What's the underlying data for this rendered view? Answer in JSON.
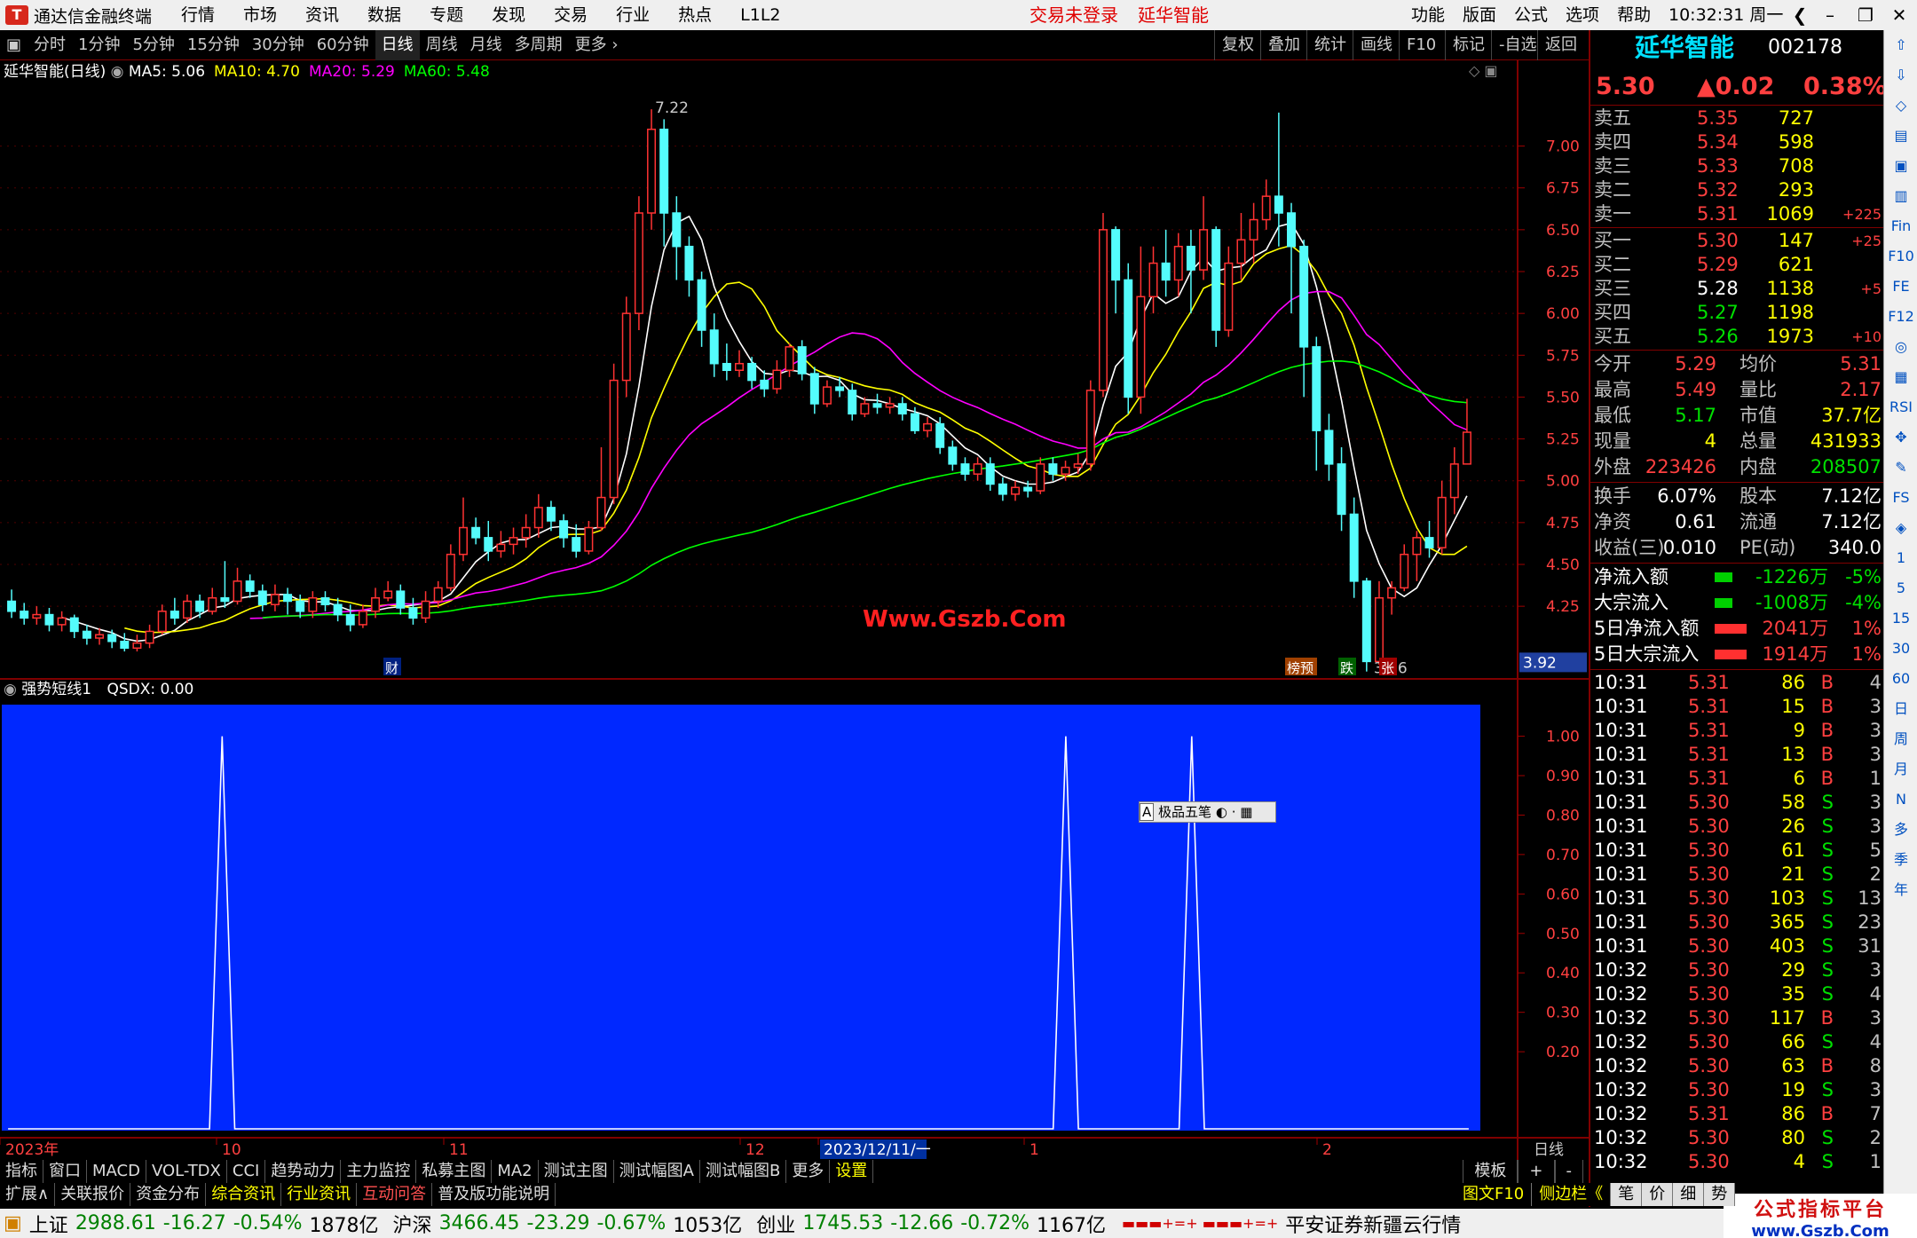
{
  "app": {
    "title": "通达信金融终端",
    "logo": "T"
  },
  "menu": [
    "行情",
    "市场",
    "资讯",
    "数据",
    "专题",
    "发现",
    "交易",
    "行业",
    "热点",
    "L1L2"
  ],
  "warn_login": "交易未登录",
  "warn_stock": "延华智能",
  "right_menu": [
    "功能",
    "版面",
    "公式",
    "选项",
    "帮助"
  ],
  "clock": "10:32:31",
  "weekday": "周一",
  "periods": [
    "分时",
    "1分钟",
    "5分钟",
    "15分钟",
    "30分钟",
    "60分钟",
    "日线",
    "周线",
    "月线",
    "多周期",
    "更多 ›"
  ],
  "active_period": "日线",
  "right_buttons": [
    "复权",
    "叠加",
    "统计",
    "画线",
    "F10",
    "标记",
    "-自选",
    "返回"
  ],
  "ma_legend": {
    "stock": "延华智能(日线)",
    "items": [
      {
        "label": "MA5: 5.06",
        "color": "#ffffff"
      },
      {
        "label": "MA10: 4.70",
        "color": "#ffff00"
      },
      {
        "label": "MA20: 5.29",
        "color": "#ff00ff"
      },
      {
        "label": "MA60: 5.48",
        "color": "#00ff00"
      }
    ]
  },
  "indicator_legend": {
    "name": "强势短线1",
    "value": "QSDX: 0.00"
  },
  "price_axis": [
    "7.00",
    "6.75",
    "6.50",
    "6.25",
    "6.00",
    "5.75",
    "5.50",
    "5.25",
    "5.00",
    "4.75",
    "4.50",
    "4.25"
  ],
  "price_axis_current": "3.92",
  "ind_axis": [
    "1.00",
    "0.90",
    "0.80",
    "0.70",
    "0.60",
    "0.50",
    "0.40",
    "0.30",
    "0.20"
  ],
  "annotations": {
    "high": "7.22",
    "low": "3.86",
    "watermark": "Www.Gszb.Com",
    "cai": "财",
    "bangyu": "榜预",
    "die": "跌",
    "zhang": "张",
    "ime": "极品五笔"
  },
  "date_axis": [
    "2023年",
    "10",
    "11",
    "12",
    "2023/12/11/一",
    "1",
    "2"
  ],
  "date_axis_right": "日线",
  "quote": {
    "name": "延华智能",
    "code": "002178",
    "price": "5.30",
    "change": "▲0.02",
    "pct": "0.38%",
    "asks": [
      {
        "label": "卖五",
        "price": "5.35",
        "vol": "727",
        "delta": ""
      },
      {
        "label": "卖四",
        "price": "5.34",
        "vol": "598",
        "delta": ""
      },
      {
        "label": "卖三",
        "price": "5.33",
        "vol": "708",
        "delta": ""
      },
      {
        "label": "卖二",
        "price": "5.32",
        "vol": "293",
        "delta": ""
      },
      {
        "label": "卖一",
        "price": "5.31",
        "vol": "1069",
        "delta": "+225"
      }
    ],
    "bids": [
      {
        "label": "买一",
        "price": "5.30",
        "vol": "147",
        "delta": "+25"
      },
      {
        "label": "买二",
        "price": "5.29",
        "vol": "621",
        "delta": ""
      },
      {
        "label": "买三",
        "price": "5.28",
        "vol": "1138",
        "delta": "+5"
      },
      {
        "label": "买四",
        "price": "5.27",
        "vol": "1198",
        "delta": ""
      },
      {
        "label": "买五",
        "price": "5.26",
        "vol": "1973",
        "delta": "+10"
      }
    ],
    "stats": [
      {
        "l1": "今开",
        "v1": "5.29",
        "l2": "均价",
        "v2": "5.31"
      },
      {
        "l1": "最高",
        "v1": "5.49",
        "l2": "量比",
        "v2": "2.17"
      },
      {
        "l1": "最低",
        "v1": "5.17",
        "l2": "市值",
        "v2": "37.7亿"
      },
      {
        "l1": "现量",
        "v1": "4",
        "l2": "总量",
        "v2": "431933"
      },
      {
        "l1": "外盘",
        "v1": "223426",
        "l2": "内盘",
        "v2": "208507"
      }
    ],
    "stats2": [
      {
        "l1": "换手",
        "v1": "6.07%",
        "l2": "股本",
        "v2": "7.12亿"
      },
      {
        "l1": "净资",
        "v1": "0.61",
        "l2": "流通",
        "v2": "7.12亿"
      },
      {
        "l1": "收益(三)",
        "v1": "0.010",
        "l2": "PE(动)",
        "v2": "340.0"
      }
    ],
    "flows": [
      {
        "label": "净流入额",
        "bar": "grn",
        "value": "-1226万",
        "pct": "-5%"
      },
      {
        "label": "大宗流入",
        "bar": "grn",
        "value": "-1008万",
        "pct": "-4%"
      },
      {
        "label": "5日净流入额",
        "bar": "red",
        "value": "2041万",
        "pct": "1%"
      },
      {
        "label": "5日大宗流入",
        "bar": "red",
        "value": "1914万",
        "pct": "1%"
      }
    ],
    "ticks": [
      {
        "t": "10:31",
        "p": "5.31",
        "v": "86",
        "bs": "B",
        "n": "4"
      },
      {
        "t": "10:31",
        "p": "5.31",
        "v": "15",
        "bs": "B",
        "n": "3"
      },
      {
        "t": "10:31",
        "p": "5.31",
        "v": "9",
        "bs": "B",
        "n": "3"
      },
      {
        "t": "10:31",
        "p": "5.31",
        "v": "13",
        "bs": "B",
        "n": "3"
      },
      {
        "t": "10:31",
        "p": "5.31",
        "v": "6",
        "bs": "B",
        "n": "1"
      },
      {
        "t": "10:31",
        "p": "5.30",
        "v": "58",
        "bs": "S",
        "n": "3"
      },
      {
        "t": "10:31",
        "p": "5.30",
        "v": "26",
        "bs": "S",
        "n": "3"
      },
      {
        "t": "10:31",
        "p": "5.30",
        "v": "61",
        "bs": "S",
        "n": "5"
      },
      {
        "t": "10:31",
        "p": "5.30",
        "v": "21",
        "bs": "S",
        "n": "2"
      },
      {
        "t": "10:31",
        "p": "5.30",
        "v": "103",
        "bs": "S",
        "n": "13"
      },
      {
        "t": "10:31",
        "p": "5.30",
        "v": "365",
        "bs": "S",
        "n": "23"
      },
      {
        "t": "10:31",
        "p": "5.30",
        "v": "403",
        "bs": "S",
        "n": "31"
      },
      {
        "t": "10:32",
        "p": "5.30",
        "v": "29",
        "bs": "S",
        "n": "3"
      },
      {
        "t": "10:32",
        "p": "5.30",
        "v": "35",
        "bs": "S",
        "n": "4"
      },
      {
        "t": "10:32",
        "p": "5.30",
        "v": "117",
        "bs": "B",
        "n": "3"
      },
      {
        "t": "10:32",
        "p": "5.30",
        "v": "66",
        "bs": "S",
        "n": "4"
      },
      {
        "t": "10:32",
        "p": "5.30",
        "v": "63",
        "bs": "B",
        "n": "8"
      },
      {
        "t": "10:32",
        "p": "5.30",
        "v": "19",
        "bs": "S",
        "n": "3"
      },
      {
        "t": "10:32",
        "p": "5.31",
        "v": "86",
        "bs": "B",
        "n": "7"
      },
      {
        "t": "10:32",
        "p": "5.30",
        "v": "80",
        "bs": "S",
        "n": "2"
      },
      {
        "t": "10:32",
        "p": "5.30",
        "v": "4",
        "bs": "S",
        "n": "1"
      }
    ]
  },
  "sidebar_items": [
    "⇧",
    "⇩",
    "◇",
    "▤",
    "▣",
    "▥",
    "Fin",
    "F10",
    "FE",
    "F12",
    "◎",
    "▦",
    "RSI",
    "✥",
    "✎",
    "FS",
    "◈",
    "1",
    "5",
    "15",
    "30",
    "60",
    "日",
    "周",
    "月",
    "N",
    "多",
    "季",
    "年"
  ],
  "bottom_tabs": [
    "指标",
    "窗口",
    "MACD",
    "VOL-TDX",
    "CCI",
    "趋势动力",
    "主力监控",
    "私募主图",
    "MA2",
    "测试主图",
    "测试幅图A",
    "测试幅图B",
    "更多",
    "设置"
  ],
  "bottom_right": [
    "模板",
    "+",
    "-"
  ],
  "bottom_tabs2": [
    {
      "label": "扩展∧",
      "color": "#ddd"
    },
    {
      "label": "关联报价",
      "color": "#ddd"
    },
    {
      "label": "资金分布",
      "color": "#ddd"
    },
    {
      "label": "综合资讯",
      "color": "#ffff00"
    },
    {
      "label": "行业资讯",
      "color": "#ffff00"
    },
    {
      "label": "互动问答",
      "color": "#ff5050"
    },
    {
      "label": "普及版功能说明",
      "color": "#ddd"
    }
  ],
  "bottom_tabs2_right": [
    "图文F10",
    "侧边栏《",
    "笔",
    "价",
    "细",
    "势"
  ],
  "status": {
    "sh_label": "上证",
    "sh_val": "2988.61",
    "sh_chg": "-16.27",
    "sh_pct": "-0.54%",
    "sh_amt": "1878亿",
    "hs_label": "沪深",
    "hs_val": "3466.45",
    "hs_chg": "-23.29",
    "hs_pct": "-0.67%",
    "hs_amt": "1053亿",
    "cy_label": "创业",
    "cy_val": "1745.53",
    "cy_chg": "-12.66",
    "cy_pct": "-0.72%",
    "cy_amt": "1167亿",
    "broker": "平安证券新疆云行情",
    "brand": "公式指标平台",
    "brand_url": "www.Gszb.Com"
  },
  "chart_data": {
    "type": "candlestick",
    "ylim": [
      3.8,
      7.3
    ],
    "candles": [
      [
        4.28,
        4.22,
        4.35,
        4.18
      ],
      [
        4.22,
        4.18,
        4.27,
        4.14
      ],
      [
        4.18,
        4.2,
        4.25,
        4.14
      ],
      [
        4.2,
        4.14,
        4.24,
        4.1
      ],
      [
        4.14,
        4.18,
        4.22,
        4.1
      ],
      [
        4.18,
        4.1,
        4.2,
        4.06
      ],
      [
        4.1,
        4.06,
        4.14,
        4.02
      ],
      [
        4.06,
        4.08,
        4.12,
        4.02
      ],
      [
        4.08,
        4.04,
        4.11,
        4.0
      ],
      [
        4.04,
        4.0,
        4.09,
        3.98
      ],
      [
        4.0,
        4.03,
        4.08,
        3.98
      ],
      [
        4.03,
        4.1,
        4.14,
        4.0
      ],
      [
        4.1,
        4.22,
        4.26,
        4.08
      ],
      [
        4.22,
        4.18,
        4.3,
        4.14
      ],
      [
        4.18,
        4.28,
        4.32,
        4.15
      ],
      [
        4.28,
        4.22,
        4.32,
        4.18
      ],
      [
        4.22,
        4.3,
        4.36,
        4.2
      ],
      [
        4.3,
        4.28,
        4.52,
        4.24
      ],
      [
        4.28,
        4.4,
        4.48,
        4.26
      ],
      [
        4.4,
        4.34,
        4.44,
        4.3
      ],
      [
        4.34,
        4.26,
        4.38,
        4.22
      ],
      [
        4.26,
        4.32,
        4.38,
        4.22
      ],
      [
        4.32,
        4.28,
        4.36,
        4.2
      ],
      [
        4.28,
        4.22,
        4.32,
        4.18
      ],
      [
        4.22,
        4.3,
        4.34,
        4.18
      ],
      [
        4.3,
        4.26,
        4.34,
        4.22
      ],
      [
        4.26,
        4.2,
        4.3,
        4.16
      ],
      [
        4.2,
        4.14,
        4.26,
        4.1
      ],
      [
        4.14,
        4.22,
        4.26,
        4.12
      ],
      [
        4.22,
        4.3,
        4.36,
        4.18
      ],
      [
        4.3,
        4.34,
        4.4,
        4.28
      ],
      [
        4.34,
        4.24,
        4.38,
        4.2
      ],
      [
        4.24,
        4.18,
        4.3,
        4.14
      ],
      [
        4.18,
        4.28,
        4.34,
        4.15
      ],
      [
        4.28,
        4.36,
        4.4,
        4.24
      ],
      [
        4.36,
        4.56,
        4.62,
        4.34
      ],
      [
        4.56,
        4.72,
        4.9,
        4.52
      ],
      [
        4.72,
        4.66,
        4.78,
        4.62
      ],
      [
        4.66,
        4.58,
        4.76,
        4.52
      ],
      [
        4.58,
        4.62,
        4.7,
        4.54
      ],
      [
        4.62,
        4.66,
        4.72,
        4.56
      ],
      [
        4.66,
        4.72,
        4.8,
        4.6
      ],
      [
        4.72,
        4.84,
        4.92,
        4.66
      ],
      [
        4.84,
        4.76,
        4.88,
        4.7
      ],
      [
        4.76,
        4.66,
        4.8,
        4.6
      ],
      [
        4.66,
        4.58,
        4.74,
        4.54
      ],
      [
        4.58,
        4.72,
        4.76,
        4.56
      ],
      [
        4.72,
        4.9,
        5.2,
        4.7
      ],
      [
        4.9,
        5.6,
        5.7,
        4.86
      ],
      [
        5.6,
        6.0,
        6.1,
        5.5
      ],
      [
        6.0,
        6.6,
        6.7,
        5.9
      ],
      [
        6.6,
        7.1,
        7.22,
        6.5
      ],
      [
        7.1,
        6.6,
        7.16,
        6.4
      ],
      [
        6.6,
        6.4,
        6.7,
        6.2
      ],
      [
        6.4,
        6.2,
        6.46,
        6.1
      ],
      [
        6.2,
        5.9,
        6.25,
        5.8
      ],
      [
        5.9,
        5.7,
        6.0,
        5.62
      ],
      [
        5.7,
        5.66,
        5.82,
        5.6
      ],
      [
        5.66,
        5.7,
        5.78,
        5.62
      ],
      [
        5.7,
        5.6,
        5.74,
        5.55
      ],
      [
        5.6,
        5.55,
        5.66,
        5.5
      ],
      [
        5.55,
        5.66,
        5.72,
        5.52
      ],
      [
        5.66,
        5.8,
        5.82,
        5.62
      ],
      [
        5.8,
        5.64,
        5.84,
        5.6
      ],
      [
        5.64,
        5.46,
        5.68,
        5.4
      ],
      [
        5.46,
        5.56,
        5.6,
        5.44
      ],
      [
        5.56,
        5.54,
        5.62,
        5.5
      ],
      [
        5.54,
        5.4,
        5.58,
        5.36
      ],
      [
        5.4,
        5.46,
        5.5,
        5.38
      ],
      [
        5.46,
        5.44,
        5.52,
        5.4
      ],
      [
        5.44,
        5.46,
        5.5,
        5.4
      ],
      [
        5.46,
        5.4,
        5.5,
        5.36
      ],
      [
        5.4,
        5.3,
        5.44,
        5.28
      ],
      [
        5.3,
        5.34,
        5.38,
        5.26
      ],
      [
        5.34,
        5.2,
        5.38,
        5.16
      ],
      [
        5.2,
        5.1,
        5.24,
        5.06
      ],
      [
        5.1,
        5.04,
        5.14,
        5.0
      ],
      [
        5.04,
        5.1,
        5.14,
        5.0
      ],
      [
        5.1,
        4.98,
        5.14,
        4.94
      ],
      [
        4.98,
        4.92,
        5.02,
        4.88
      ],
      [
        4.92,
        4.96,
        5.0,
        4.88
      ],
      [
        4.96,
        4.94,
        5.0,
        4.9
      ],
      [
        4.94,
        5.1,
        5.14,
        4.92
      ],
      [
        5.1,
        5.04,
        5.14,
        5.0
      ],
      [
        5.04,
        5.08,
        5.12,
        5.0
      ],
      [
        5.08,
        5.1,
        5.16,
        5.04
      ],
      [
        5.1,
        5.54,
        5.6,
        5.06
      ],
      [
        5.54,
        6.5,
        6.6,
        5.5
      ],
      [
        6.5,
        6.2,
        6.52,
        6.0
      ],
      [
        6.2,
        5.5,
        6.3,
        5.4
      ],
      [
        5.5,
        6.1,
        6.4,
        5.4
      ],
      [
        6.1,
        6.3,
        6.4,
        6.0
      ],
      [
        6.3,
        6.2,
        6.5,
        6.1
      ],
      [
        6.2,
        6.4,
        6.48,
        6.1
      ],
      [
        6.4,
        6.26,
        6.5,
        6.0
      ],
      [
        6.26,
        6.5,
        6.7,
        6.2
      ],
      [
        6.5,
        5.9,
        6.52,
        5.8
      ],
      [
        5.9,
        6.3,
        6.4,
        5.86
      ],
      [
        6.3,
        6.44,
        6.6,
        6.2
      ],
      [
        6.44,
        6.56,
        6.66,
        6.3
      ],
      [
        6.56,
        6.7,
        6.8,
        6.5
      ],
      [
        6.7,
        6.6,
        7.2,
        6.4
      ],
      [
        6.6,
        6.4,
        6.66,
        6.0
      ],
      [
        6.4,
        5.8,
        6.44,
        5.5
      ],
      [
        5.8,
        5.3,
        5.86,
        5.06
      ],
      [
        5.3,
        5.1,
        5.4,
        5.0
      ],
      [
        5.1,
        4.8,
        5.2,
        4.7
      ],
      [
        4.8,
        4.4,
        4.9,
        4.3
      ],
      [
        4.4,
        3.92,
        4.42,
        3.86
      ],
      [
        3.92,
        4.3,
        4.4,
        3.9
      ],
      [
        4.3,
        4.36,
        4.4,
        4.2
      ],
      [
        4.36,
        4.56,
        4.62,
        4.34
      ],
      [
        4.56,
        4.66,
        4.7,
        4.4
      ],
      [
        4.66,
        4.6,
        4.76,
        4.54
      ],
      [
        4.6,
        4.9,
        5.0,
        4.56
      ],
      [
        4.9,
        5.1,
        5.2,
        4.8
      ],
      [
        5.1,
        5.29,
        5.49,
        5.17
      ]
    ],
    "indicator": {
      "name": "QSDX",
      "ylim": [
        0,
        1.05
      ],
      "spikes_at": [
        17,
        84,
        94
      ],
      "value": 0.0
    }
  }
}
